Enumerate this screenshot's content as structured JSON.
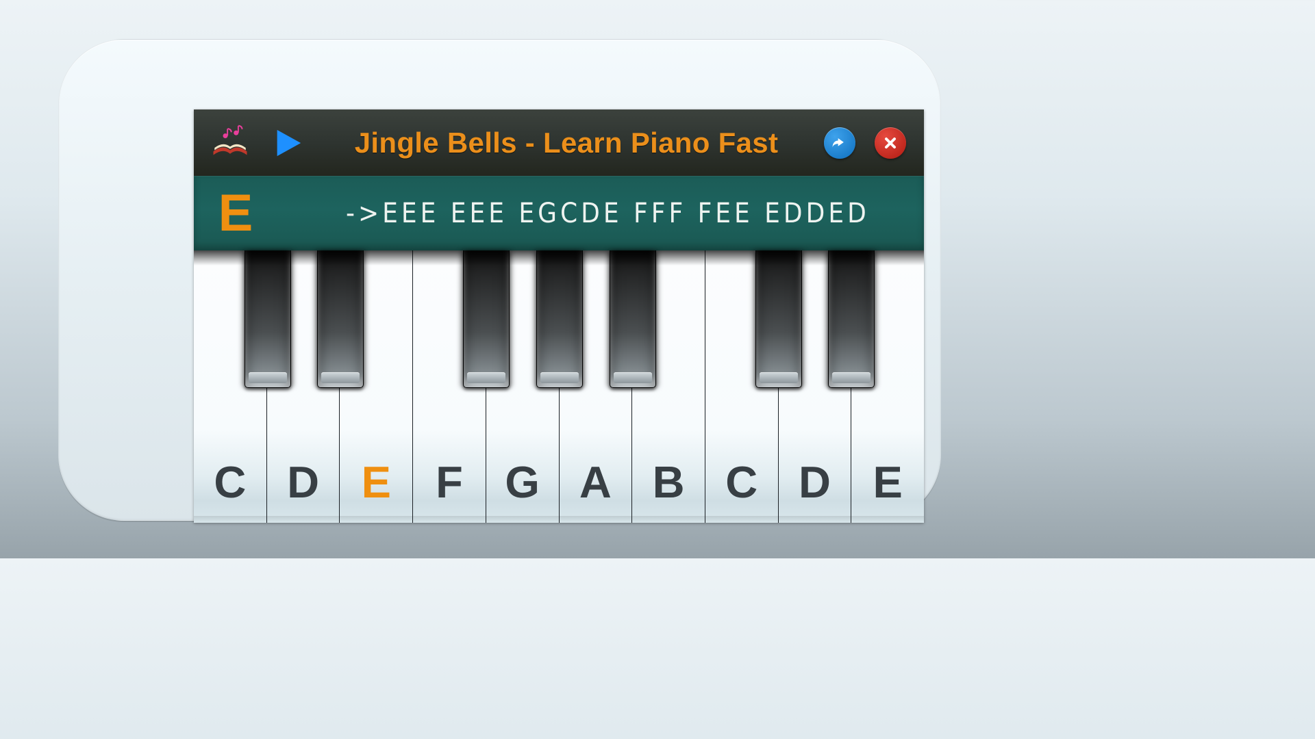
{
  "colors": {
    "accent": "#eb8f1b",
    "teal": "#1b5c57"
  },
  "topbar": {
    "title": "Jingle Bells - Learn Piano Fast"
  },
  "sequence": {
    "current_note": "E",
    "notes_text": "->EEE EEE EGCDE  FFF FEE EDDED"
  },
  "keyboard": {
    "white_keys": [
      {
        "label": "C",
        "current": false
      },
      {
        "label": "D",
        "current": false
      },
      {
        "label": "E",
        "current": true
      },
      {
        "label": "F",
        "current": false
      },
      {
        "label": "G",
        "current": false
      },
      {
        "label": "A",
        "current": false
      },
      {
        "label": "B",
        "current": false
      },
      {
        "label": "C",
        "current": false
      },
      {
        "label": "D",
        "current": false
      },
      {
        "label": "E",
        "current": false
      }
    ],
    "black_keys": [
      {
        "name": "C#"
      },
      {
        "name": "D#"
      },
      {
        "name": "F#"
      },
      {
        "name": "G#"
      },
      {
        "name": "A#"
      },
      {
        "name": "C#"
      },
      {
        "name": "D#"
      }
    ]
  }
}
